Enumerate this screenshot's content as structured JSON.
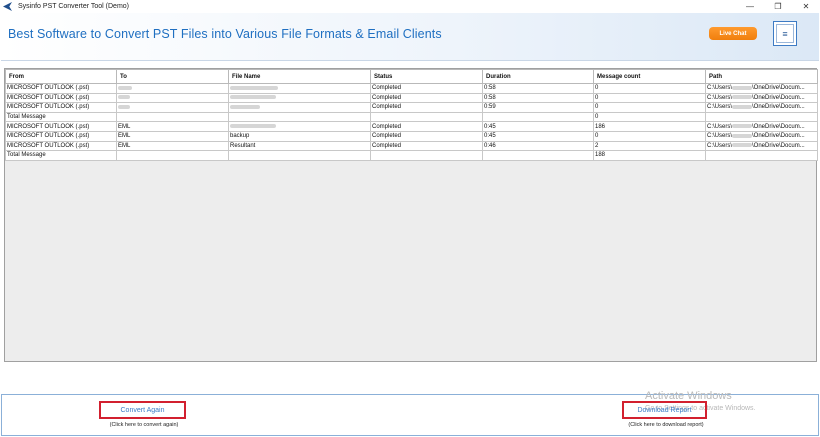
{
  "window": {
    "title": "Sysinfo PST Converter Tool (Demo)",
    "controls": [
      "—",
      "❐",
      "✕"
    ]
  },
  "header": {
    "title": "Best Software to Convert PST Files into Various File Formats & Email Clients",
    "live_chat": "Live Chat",
    "menu_glyph": "≡"
  },
  "table": {
    "columns": [
      "From",
      "To",
      "File Name",
      "Status",
      "Duration",
      "Message count",
      "Path"
    ],
    "rows": [
      {
        "from": "MICROSOFT OUTLOOK (.pst)",
        "to": "",
        "file": "",
        "status": "Completed",
        "duration": "0:58",
        "count": "0",
        "path_prefix": "C:\\Users\\",
        "path_suffix": "\\OneDrive\\Docum..."
      },
      {
        "from": "MICROSOFT OUTLOOK (.pst)",
        "to": "",
        "file": "",
        "status": "Completed",
        "duration": "0:58",
        "count": "0",
        "path_prefix": "C:\\Users\\",
        "path_suffix": "\\OneDrive\\Docum..."
      },
      {
        "from": "MICROSOFT OUTLOOK (.pst)",
        "to": "",
        "file": "",
        "status": "Completed",
        "duration": "0:59",
        "count": "0",
        "path_prefix": "C:\\Users\\",
        "path_suffix": "\\OneDrive\\Docum..."
      },
      {
        "from": "Total Message",
        "to": "",
        "file": "",
        "status": "",
        "duration": "",
        "count": "0",
        "path_prefix": "",
        "path_suffix": ""
      },
      {
        "from": "MICROSOFT OUTLOOK (.pst)",
        "to": "EML",
        "file": "",
        "status": "Completed",
        "duration": "0:45",
        "count": "186",
        "path_prefix": "C:\\Users\\",
        "path_suffix": "\\OneDrive\\Docum..."
      },
      {
        "from": "MICROSOFT OUTLOOK (.pst)",
        "to": "EML",
        "file": "backup",
        "status": "Completed",
        "duration": "0:45",
        "count": "0",
        "path_prefix": "C:\\Users\\",
        "path_suffix": "\\OneDrive\\Docum..."
      },
      {
        "from": "MICROSOFT OUTLOOK (.pst)",
        "to": "EML",
        "file": "Resultant",
        "status": "Completed",
        "duration": "0:46",
        "count": "2",
        "path_prefix": "C:\\Users\\",
        "path_suffix": "\\OneDrive\\Docum..."
      },
      {
        "from": "Total Message",
        "to": "",
        "file": "",
        "status": "",
        "duration": "",
        "count": "188",
        "path_prefix": "",
        "path_suffix": ""
      }
    ]
  },
  "footer": {
    "convert_again": "Convert Again",
    "convert_hint": "(Click here to convert again)",
    "download_report": "Download Report",
    "download_hint": "(Click here to download report)",
    "watermark_title": "Activate Windows",
    "watermark_sub": "Go to Settings to activate Windows."
  },
  "colors": {
    "accent": "#1f6fc1",
    "live_chat": "#f58a1f",
    "highlight_box": "#d2202f"
  },
  "icons": [
    "app-logo-icon",
    "minimize-icon",
    "restore-icon",
    "close-icon",
    "hamburger-menu-icon"
  ]
}
